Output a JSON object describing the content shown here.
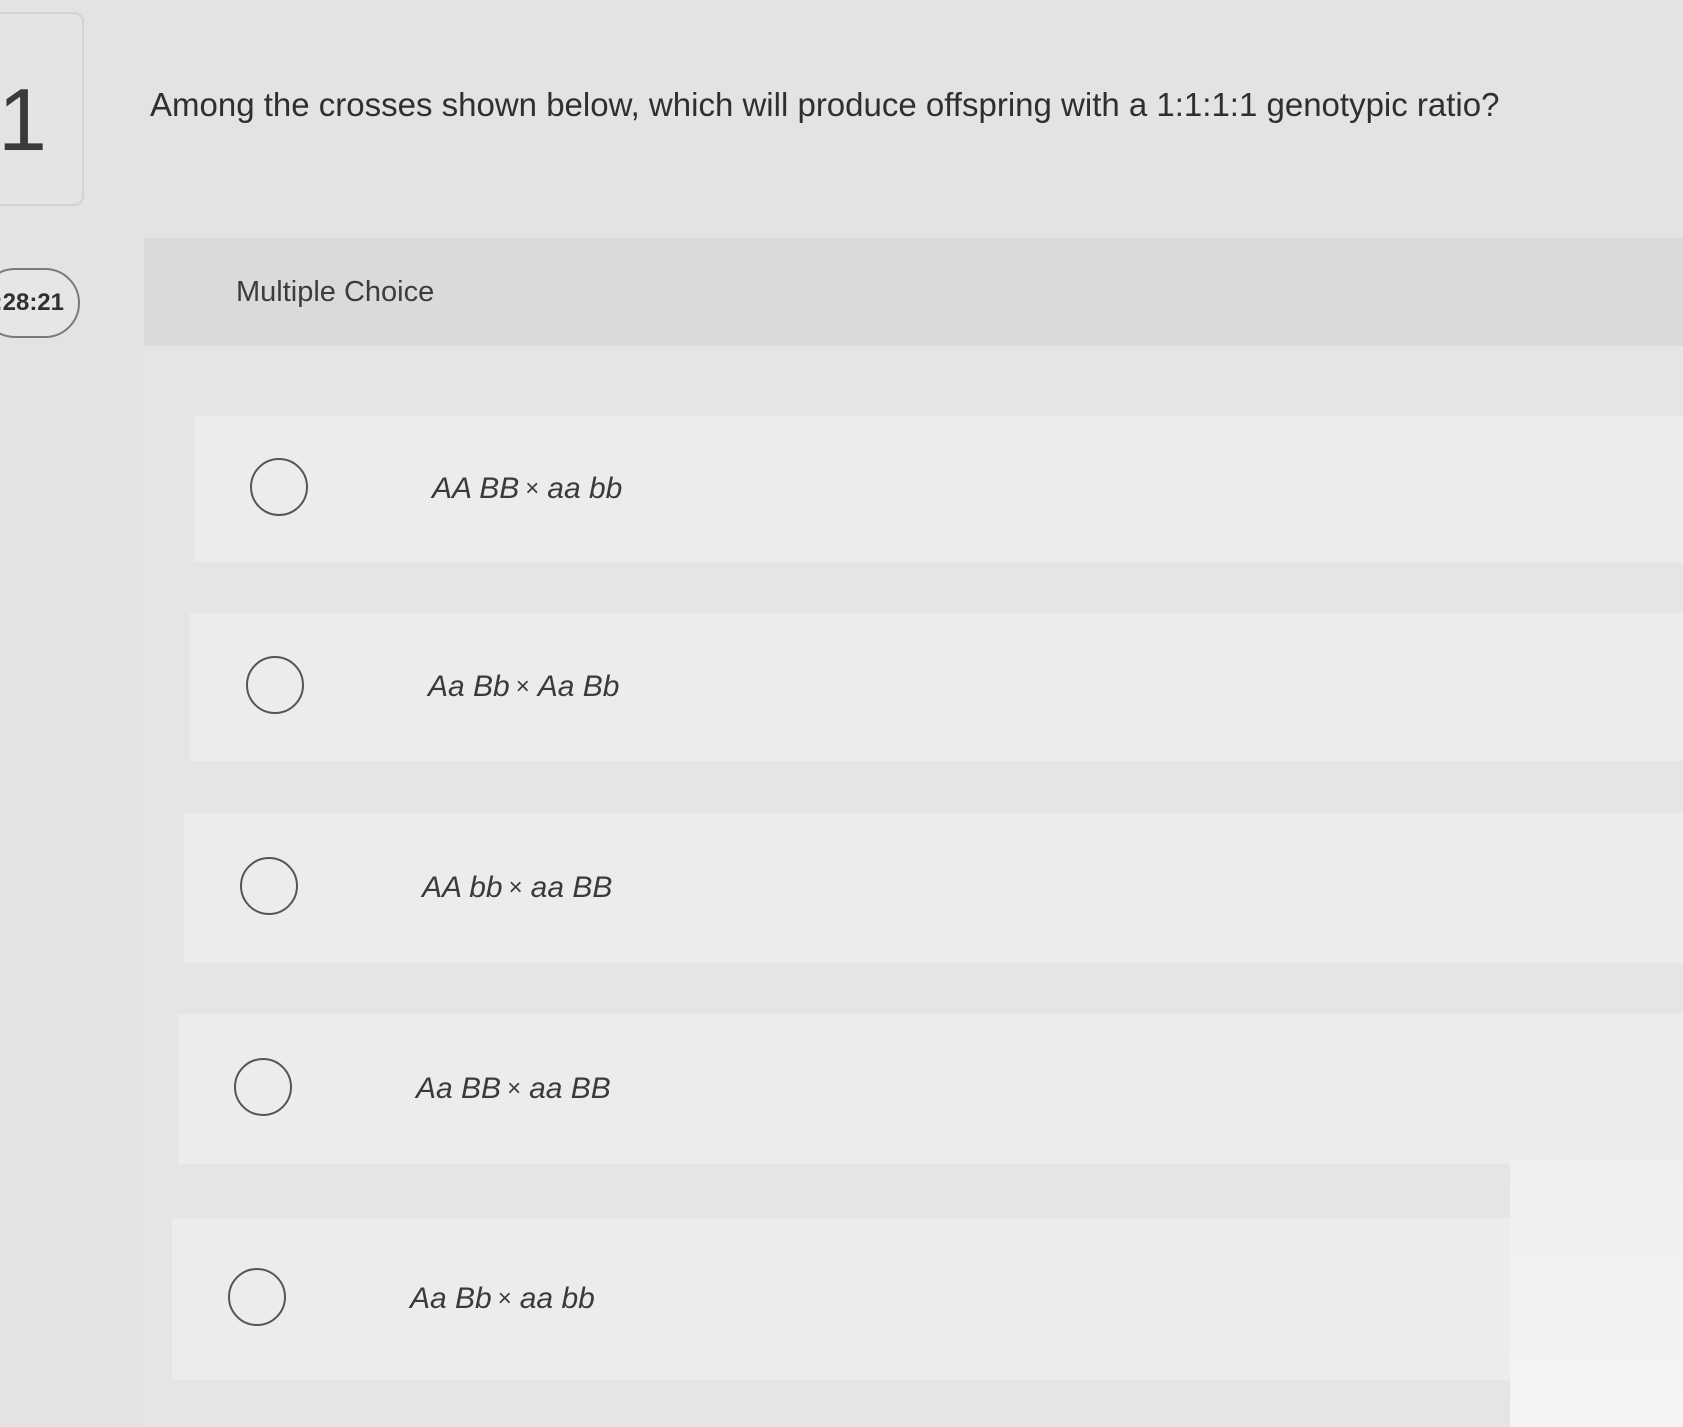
{
  "question": {
    "number": "1",
    "timer": ":28:21",
    "prompt": "Among the crosses shown below, which will produce offspring with a 1:1:1:1 genotypic ratio?"
  },
  "choices": {
    "title": "Multiple Choice",
    "options": [
      {
        "left": "AA BB",
        "right": "aa bb"
      },
      {
        "left": "Aa Bb",
        "right": "Aa Bb"
      },
      {
        "left": "AA bb",
        "right": "aa BB"
      },
      {
        "left": "Aa BB",
        "right": "aa BB"
      },
      {
        "left": "Aa Bb",
        "right": "aa bb"
      }
    ],
    "times_symbol": "×"
  }
}
